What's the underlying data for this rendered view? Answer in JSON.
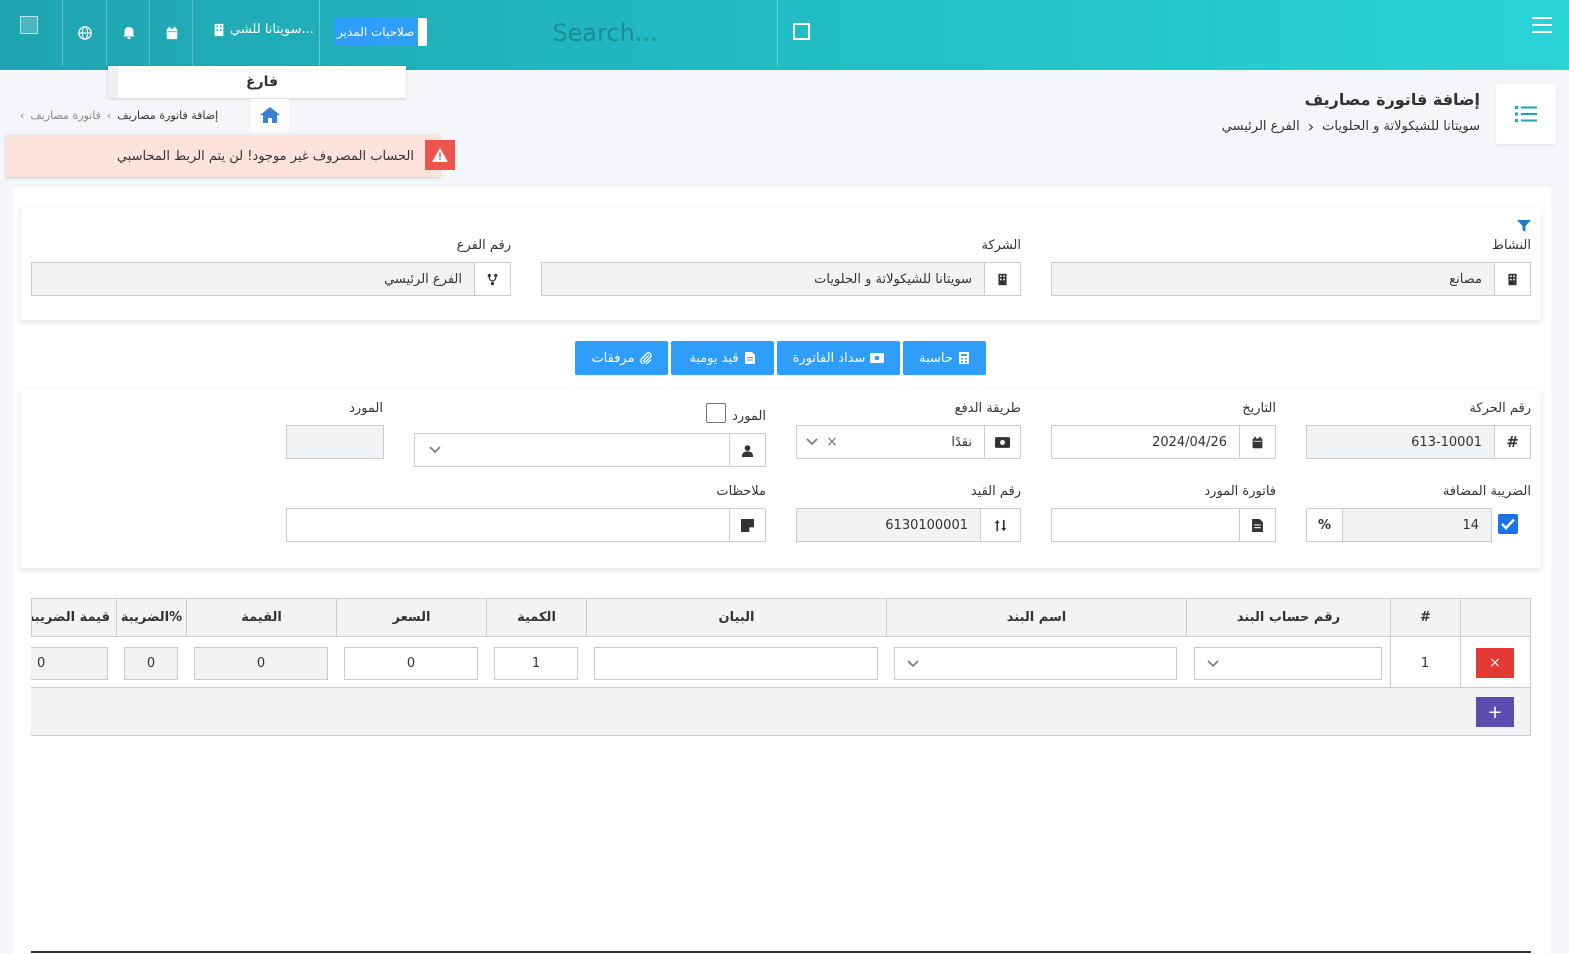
{
  "header": {
    "branch_label": "سويتانا للشي...",
    "admin_label": "صلاحيات المدير",
    "search_placeholder": "Search..."
  },
  "dropdown": {
    "text": "فارغ"
  },
  "page": {
    "title": "إضافة فاتورة مصاريف",
    "company": "سويتانا للشيكولاتة و الحلويات",
    "branch": "الفرع الرئيسي"
  },
  "breadcrumb": {
    "parent": "فاتورة مصاريف",
    "current": "إضافة فاتورة مصاريف"
  },
  "alert": {
    "message": "الحساب المصروف غير موجود! لن يتم الربط المحاسبي"
  },
  "filters": {
    "activity": {
      "label": "النشاط",
      "value": "مصانع"
    },
    "company": {
      "label": "الشركة",
      "value": "سويتانا للشيكولاتة و الحلويات"
    },
    "branch": {
      "label": "رقم الفرع",
      "value": "الفرع الرئيسي"
    }
  },
  "actions": {
    "calculator": "حاسبة",
    "pay": "سداد الفاتورة",
    "journal": "قيد يومية",
    "attachments": "مرفقات"
  },
  "form": {
    "txn_no": {
      "label": "رقم الحركة",
      "value": "613-10001"
    },
    "date": {
      "label": "التاريخ",
      "value": "2024/04/26"
    },
    "payment": {
      "label": "طريقة الدفع",
      "value": "نقدًا"
    },
    "supplier_select": {
      "label": "المورد"
    },
    "supplier_code": {
      "label": "المورد"
    },
    "vat": {
      "label": "الضريبة المضافة",
      "value": "14"
    },
    "supplier_invoice": {
      "label": "فاتورة المورد"
    },
    "entry_no": {
      "label": "رقم القيد",
      "value": "6130100001"
    },
    "notes": {
      "label": "ملاحظات"
    }
  },
  "table": {
    "headers": {
      "num": "#",
      "account": "رقم حساب البند",
      "item": "اسم البند",
      "desc": "البيان",
      "qty": "الكمية",
      "price": "السعر",
      "value": "القيمة",
      "tax": "الضريبة%",
      "tax_value": "قيمة الضريبة"
    },
    "rows": [
      {
        "num": "1",
        "qty": "1",
        "price": "0",
        "value": "0",
        "tax": "0",
        "tax_value": "0"
      }
    ],
    "delete_label": "×",
    "add_label": "+"
  }
}
